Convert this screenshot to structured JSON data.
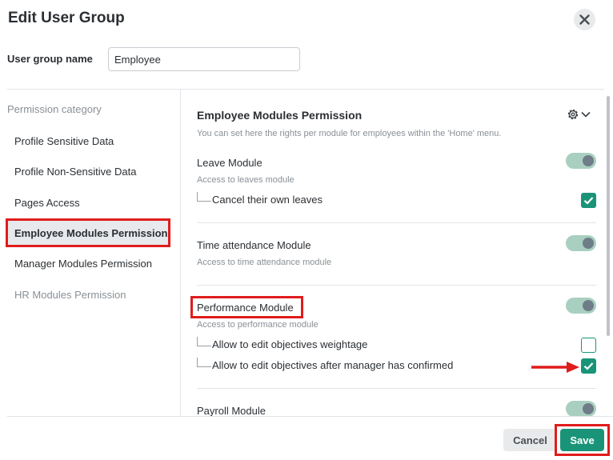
{
  "dialog": {
    "title": "Edit User Group"
  },
  "group_name": {
    "label": "User group name",
    "value": "Employee"
  },
  "sidebar": {
    "heading": "Permission category",
    "items": [
      {
        "label": "Profile Sensitive Data"
      },
      {
        "label": "Profile Non-Sensitive Data"
      },
      {
        "label": "Pages Access"
      },
      {
        "label": "Employee Modules Permission"
      },
      {
        "label": "Manager Modules Permission"
      },
      {
        "label": "HR Modules Permission"
      }
    ]
  },
  "section": {
    "title": "Employee Modules Permission",
    "description": "You can set here the rights per module for employees within the 'Home' menu.",
    "settings_icon": "gear-icon",
    "modules": [
      {
        "title": "Leave Module",
        "description": "Access to leaves module",
        "enabled": true,
        "options": [
          {
            "label": "Cancel their own leaves",
            "checked": true
          }
        ]
      },
      {
        "title": "Time attendance Module",
        "description": "Access to time attendance module",
        "enabled": true,
        "options": []
      },
      {
        "title": "Performance Module",
        "description": "Access to performance module",
        "enabled": true,
        "options": [
          {
            "label": "Allow to edit objectives weightage",
            "checked": false
          },
          {
            "label": "Allow to edit objectives after manager has confirmed",
            "checked": true
          }
        ]
      },
      {
        "title": "Payroll Module",
        "enabled": true
      }
    ]
  },
  "footer": {
    "cancel_label": "Cancel",
    "save_label": "Save"
  },
  "colors": {
    "accent": "#1a9479",
    "highlight": "#e01c1c",
    "toggle_track": "#a9cfc0"
  }
}
